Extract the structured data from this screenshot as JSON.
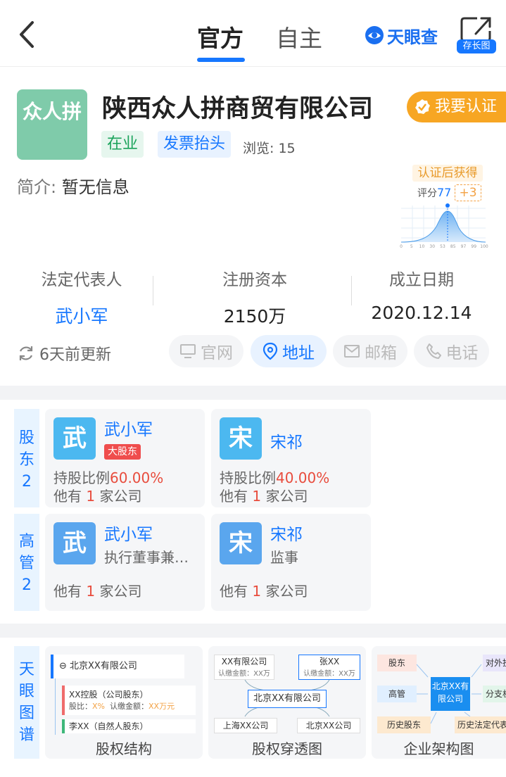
{
  "header": {
    "tabs": [
      {
        "label": "官方"
      },
      {
        "label": "自主"
      }
    ],
    "logo": "天眼查",
    "share_label": "存长图"
  },
  "company": {
    "logo_text": "众人拼",
    "name": "陕西众人拼商贸有限公司",
    "certify_label": "我要认证",
    "status_tag": "在业",
    "invoice_tag": "发票抬头",
    "views_label": "浏览:",
    "views": "15",
    "intro_label": "简介:",
    "intro": "暂无信息"
  },
  "score": {
    "badge": "认证后获得",
    "label": "评分",
    "value": "77",
    "plus": "+3",
    "axis_ticks": [
      "0",
      "5",
      "10",
      "30",
      "53",
      "85",
      "97",
      "99",
      "100"
    ]
  },
  "key_info": {
    "legal_rep_label": "法定代表人",
    "legal_rep": "武小军",
    "capital_label": "注册资本",
    "capital": "2150万",
    "founded_label": "成立日期",
    "founded": "2020.12.14"
  },
  "updated": "6天前更新",
  "actions": [
    {
      "label": "官网",
      "icon": "monitor-icon"
    },
    {
      "label": "地址",
      "icon": "location-pin-icon"
    },
    {
      "label": "邮箱",
      "icon": "mail-icon"
    },
    {
      "label": "电话",
      "icon": "phone-icon"
    }
  ],
  "shareholders": {
    "label": "股东",
    "count": "2",
    "items": [
      {
        "avatar": "武",
        "avatar_color": "#4cb8f0",
        "name": "武小军",
        "badge": "大股东",
        "ratio_label": "持股比例",
        "ratio": "60.00%",
        "other_pre": "他有",
        "other_count": "1",
        "other_post": "家公司"
      },
      {
        "avatar": "宋",
        "avatar_color": "#4cb8f0",
        "name": "宋祁",
        "ratio_label": "持股比例",
        "ratio": "40.00%",
        "other_pre": "他有",
        "other_count": "1",
        "other_post": "家公司"
      }
    ]
  },
  "executives": {
    "label": "高管",
    "count": "2",
    "items": [
      {
        "avatar": "武",
        "avatar_color": "#5aa6ee",
        "name": "武小军",
        "role": "执行董事兼…",
        "other_pre": "他有",
        "other_count": "1",
        "other_post": "家公司"
      },
      {
        "avatar": "宋",
        "avatar_color": "#5aa6ee",
        "name": "宋祁",
        "role": "监事",
        "other_pre": "他有",
        "other_count": "1",
        "other_post": "家公司"
      }
    ]
  },
  "graphs": {
    "label": "天眼图谱",
    "cards": [
      {
        "title": "股权结构",
        "root": "北京XX有限公司",
        "node1": "XX控股（公司股东）",
        "node1_sub_a": "股比：",
        "node1_sub_a_val": "X%",
        "node1_sub_b": "认缴金额：",
        "node1_sub_b_val": "XX万元",
        "node2": "李XX（自然人股东）"
      },
      {
        "title": "股权穿透图",
        "top_left": "XX有限公司",
        "top_left_sub": "认缴金额：XX万",
        "top_right": "张XX",
        "top_right_sub": "认缴金额：XX万",
        "center": "北京XX有限公司",
        "bottom_left": "上海XX公司",
        "bottom_right": "北京XX公司"
      },
      {
        "title": "企业架构图",
        "left": [
          "股东",
          "高管",
          "历史股东"
        ],
        "center": "北京XX有限公司",
        "right": [
          "对外投",
          "分支机",
          "历史法定代表"
        ]
      }
    ]
  },
  "colors": {
    "accent": "#1677ff",
    "orange": "#f7a623",
    "green": "#1aa35a",
    "red": "#e84c3d"
  }
}
